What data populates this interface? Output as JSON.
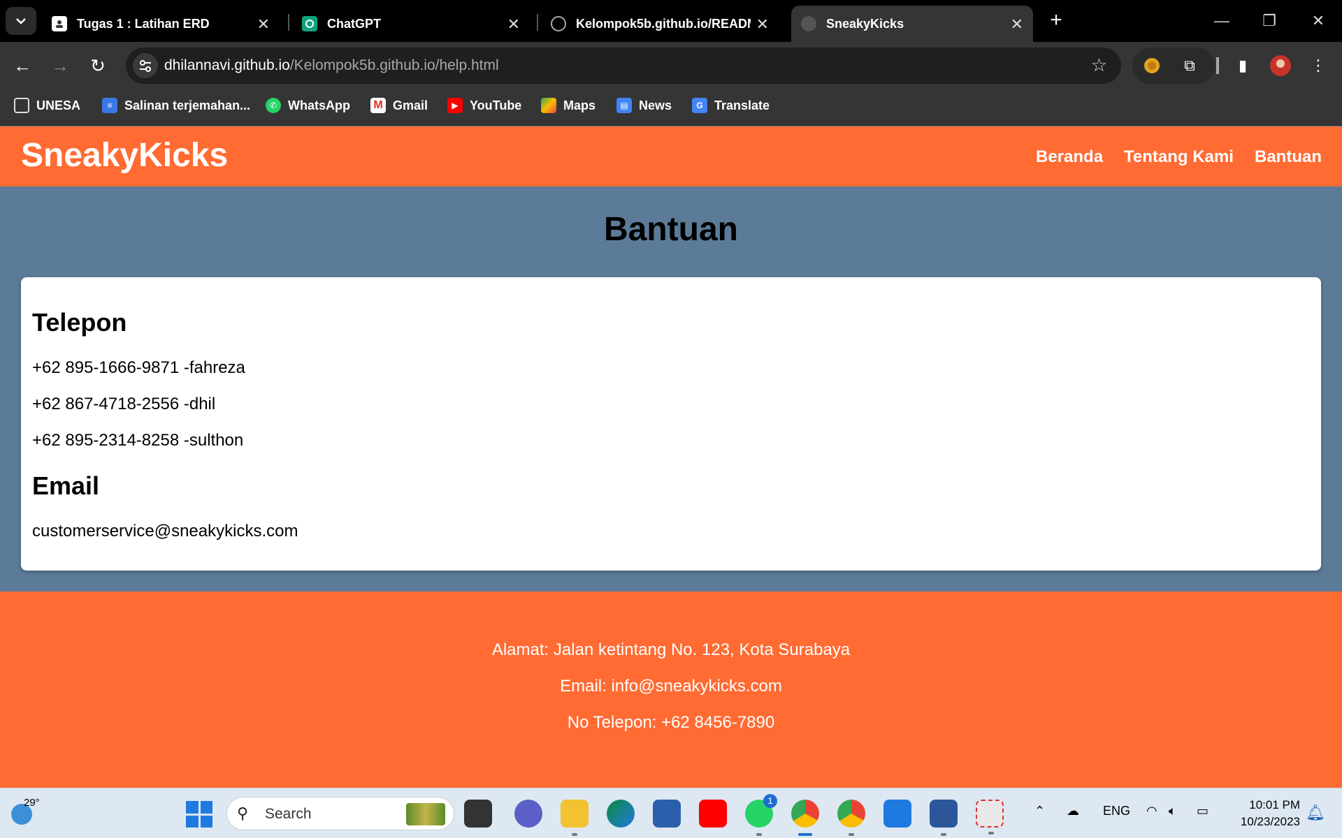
{
  "browser": {
    "tabs": [
      {
        "title": "Tugas 1 : Latihan ERD",
        "active": false
      },
      {
        "title": "ChatGPT",
        "active": false
      },
      {
        "title": "Kelompok5b.github.io/READM",
        "active": false
      },
      {
        "title": "SneakyKicks",
        "active": true
      }
    ],
    "url_host": "dhilannavi.github.io",
    "url_path": "/Kelompok5b.github.io/help.html",
    "bookmarks": [
      "UNESA",
      "Salinan terjemahan...",
      "WhatsApp",
      "Gmail",
      "YouTube",
      "Maps",
      "News",
      "Translate"
    ]
  },
  "site": {
    "logo": "SneakyKicks",
    "nav": [
      "Beranda",
      "Tentang Kami",
      "Bantuan"
    ],
    "page_title": "Bantuan",
    "phone_heading": "Telepon",
    "phones": [
      "+62 895-1666-9871 -fahreza",
      "+62 867-4718-2556 -dhil",
      "+62 895-2314-8258 -sulthon"
    ],
    "email_heading": "Email",
    "email": "customerservice@sneakykicks.com",
    "footer": {
      "address": "Alamat: Jalan ketintang No. 123, Kota Surabaya",
      "email": "Email: info@sneakykicks.com",
      "phone": "No Telepon: +62 8456-7890"
    },
    "colors": {
      "header": "#ff6b33",
      "background": "#5b7b98",
      "card": "#ffffff"
    }
  },
  "taskbar": {
    "weather_temp": "29°",
    "search_placeholder": "Search",
    "whatsapp_badge": "1",
    "language": "ENG",
    "time": "10:01 PM",
    "date": "10/23/2023"
  }
}
